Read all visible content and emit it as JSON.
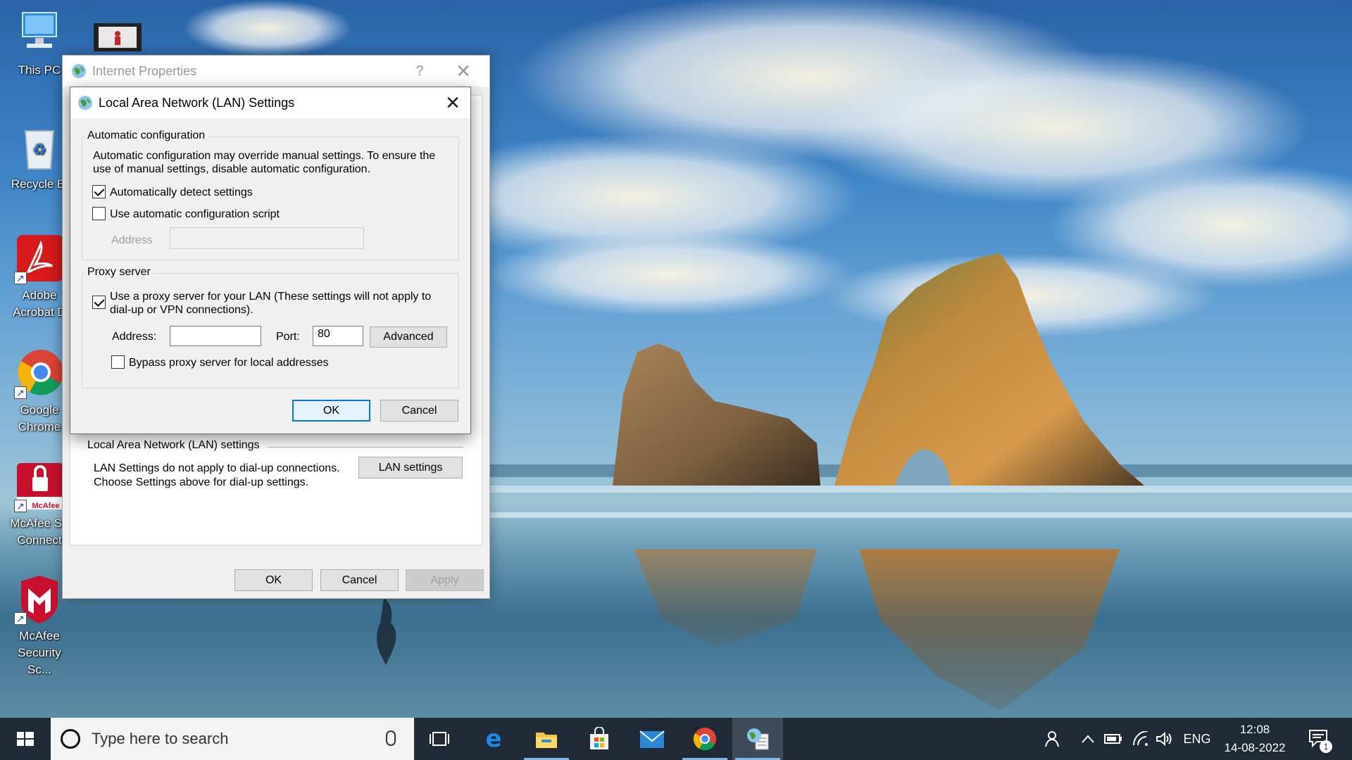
{
  "desktop": {
    "icons": [
      {
        "label": "This PC",
        "icon": "computer-icon"
      },
      {
        "label": "Recycle Bi",
        "icon": "recycle-bin-icon"
      },
      {
        "label": "Adobe Acrobat D",
        "line1": "Adobe",
        "line2": "Acrobat D",
        "icon": "acrobat-icon"
      },
      {
        "label": "Google Chrome",
        "line1": "Google",
        "line2": "Chrome",
        "icon": "chrome-icon"
      },
      {
        "label": "McAfee Sa Connect",
        "line1": "McAfee Sa",
        "line2": "Connect",
        "badge": "McAfee",
        "icon": "mcafee-safe-connect-icon"
      },
      {
        "label": "McAfee Security Sc...",
        "line1": "McAfee",
        "line2": "Security Sc...",
        "icon": "mcafee-security-icon"
      }
    ]
  },
  "internet_properties": {
    "title": "Internet Properties",
    "help_glyph": "?",
    "close_glyph": "✕",
    "lan_section": {
      "title": "Local Area Network (LAN) settings",
      "line1": "LAN Settings do not apply to dial-up connections.",
      "line2": "Choose Settings above for dial-up settings.",
      "button": "LAN settings"
    },
    "buttons": {
      "ok": "OK",
      "cancel": "Cancel",
      "apply": "Apply"
    }
  },
  "lan_dialog": {
    "title": "Local Area Network (LAN) Settings",
    "close_glyph": "✕",
    "auto_config": {
      "group_label": "Automatic configuration",
      "desc_line1": "Automatic configuration may override manual settings.  To ensure the",
      "desc_line2": "use of manual settings, disable automatic configuration.",
      "auto_detect": {
        "label": "Automatically detect settings",
        "checked": true
      },
      "use_script": {
        "label": "Use automatic configuration script",
        "checked": false
      },
      "address_label": "Address",
      "address_value": ""
    },
    "proxy": {
      "group_label": "Proxy server",
      "use_proxy_line1": "Use a proxy server for your LAN (These settings will not apply to",
      "use_proxy_line2": "dial-up or VPN connections).",
      "use_proxy_checked": true,
      "address_label": "Address:",
      "address_value": "",
      "port_label": "Port:",
      "port_value": "80",
      "advanced_button": "Advanced",
      "bypass_label": "Bypass proxy server for local addresses",
      "bypass_checked": false
    },
    "buttons": {
      "ok": "OK",
      "cancel": "Cancel"
    }
  },
  "taskbar": {
    "search_placeholder": "Type here to search",
    "language": "ENG",
    "time": "12:08",
    "date": "14-08-2022",
    "notification_count": "1",
    "colors": {
      "taskbar": "#1f2a36",
      "accent": "#0078d7"
    }
  }
}
